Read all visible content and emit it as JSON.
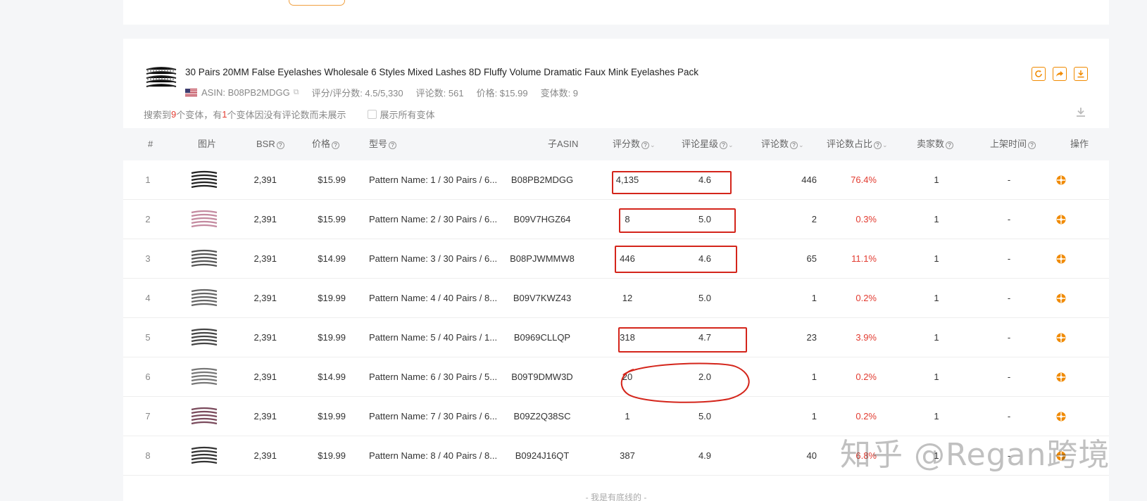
{
  "product": {
    "title": "30 Pairs 20MM False Eyelashes Wholesale 6 Styles Mixed Lashes 8D Fluffy Volume Dramatic Faux Mink Eyelashes Pack",
    "asin": "ASIN: B08PB2MDGG",
    "rating": "评分/评分数: 4.5/5,330",
    "reviews": "评论数: 561",
    "price": "价格: $15.99",
    "variants": "变体数: 9"
  },
  "note": {
    "prefix": "搜索到",
    "count": "9",
    "middle": "个变体，有",
    "missing": "1",
    "suffix": "个变体因没有评论数而未展示",
    "show_all": "展示所有变体"
  },
  "headers": {
    "idx": "#",
    "img": "图片",
    "bsr": "BSR",
    "price": "价格",
    "model": "型号",
    "child_asin": "子ASIN",
    "rating_count": "评分数",
    "star": "评论星级",
    "review_count": "评论数",
    "review_pct": "评论数占比",
    "sellers": "卖家数",
    "listed": "上架时间",
    "action": "操作"
  },
  "rows": [
    {
      "idx": "1",
      "bsr": "2,391",
      "price": "$15.99",
      "model": "Pattern Name: 1 / 30 Pairs / 6...",
      "asin": "B08PB2MDGG",
      "ratings": "4,135",
      "star": "4.6",
      "reviews": "446",
      "pct": "76.4%",
      "sellers": "1",
      "listed": "-"
    },
    {
      "idx": "2",
      "bsr": "2,391",
      "price": "$15.99",
      "model": "Pattern Name: 2 / 30 Pairs / 6...",
      "asin": "B09V7HGZ64",
      "ratings": "8",
      "star": "5.0",
      "reviews": "2",
      "pct": "0.3%",
      "sellers": "1",
      "listed": "-"
    },
    {
      "idx": "3",
      "bsr": "2,391",
      "price": "$14.99",
      "model": "Pattern Name: 3 / 30 Pairs / 6...",
      "asin": "B08PJWMMW8",
      "ratings": "446",
      "star": "4.6",
      "reviews": "65",
      "pct": "11.1%",
      "sellers": "1",
      "listed": "-"
    },
    {
      "idx": "4",
      "bsr": "2,391",
      "price": "$19.99",
      "model": "Pattern Name: 4 / 40 Pairs / 8...",
      "asin": "B09V7KWZ43",
      "ratings": "12",
      "star": "5.0",
      "reviews": "1",
      "pct": "0.2%",
      "sellers": "1",
      "listed": "-"
    },
    {
      "idx": "5",
      "bsr": "2,391",
      "price": "$19.99",
      "model": "Pattern Name: 5 / 40 Pairs / 1...",
      "asin": "B0969CLLQP",
      "ratings": "318",
      "star": "4.7",
      "reviews": "23",
      "pct": "3.9%",
      "sellers": "1",
      "listed": "-"
    },
    {
      "idx": "6",
      "bsr": "2,391",
      "price": "$14.99",
      "model": "Pattern Name: 6 / 30 Pairs / 5...",
      "asin": "B09T9DMW3D",
      "ratings": "20",
      "star": "2.0",
      "reviews": "1",
      "pct": "0.2%",
      "sellers": "1",
      "listed": "-"
    },
    {
      "idx": "7",
      "bsr": "2,391",
      "price": "$19.99",
      "model": "Pattern Name: 7 / 30 Pairs / 6...",
      "asin": "B09Z2Q38SC",
      "ratings": "1",
      "star": "5.0",
      "reviews": "1",
      "pct": "0.2%",
      "sellers": "1",
      "listed": "-"
    },
    {
      "idx": "8",
      "bsr": "2,391",
      "price": "$19.99",
      "model": "Pattern Name: 8 / 40 Pairs / 8...",
      "asin": "B0924J16QT",
      "ratings": "387",
      "star": "4.9",
      "reviews": "40",
      "pct": "6.8%",
      "sellers": "1",
      "listed": "-"
    }
  ],
  "footer": "- 我是有底线的 -",
  "watermark": "知乎 @Regan跨境",
  "colors": {
    "accent": "#f08a00",
    "highlight": "#d4251b",
    "percent": "#e23b30"
  }
}
